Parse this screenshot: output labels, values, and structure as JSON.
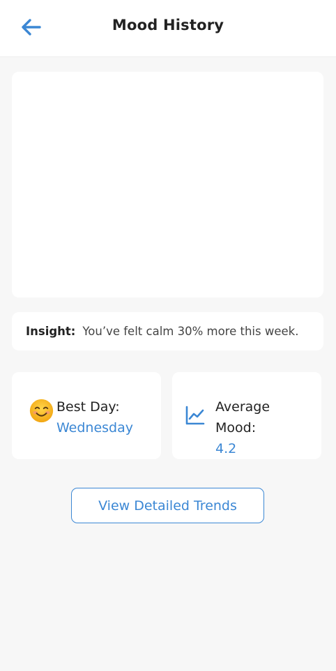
{
  "header": {
    "title": "Mood History",
    "back_icon": "arrow-left-icon"
  },
  "insight": {
    "label": "Insight:",
    "text": "You’ve felt calm 30% more this week."
  },
  "stats": {
    "best_day": {
      "icon": "smiling-face-emoji",
      "label": "Best Day:",
      "value": "Wednesday"
    },
    "average_mood": {
      "icon": "trend-chart-icon",
      "label": "Average Mood:",
      "value": "4.2"
    }
  },
  "actions": {
    "view_trends": "View Detailed Trends"
  },
  "colors": {
    "accent": "#3b87d4",
    "background": "#f7f7f7",
    "card": "#ffffff"
  }
}
